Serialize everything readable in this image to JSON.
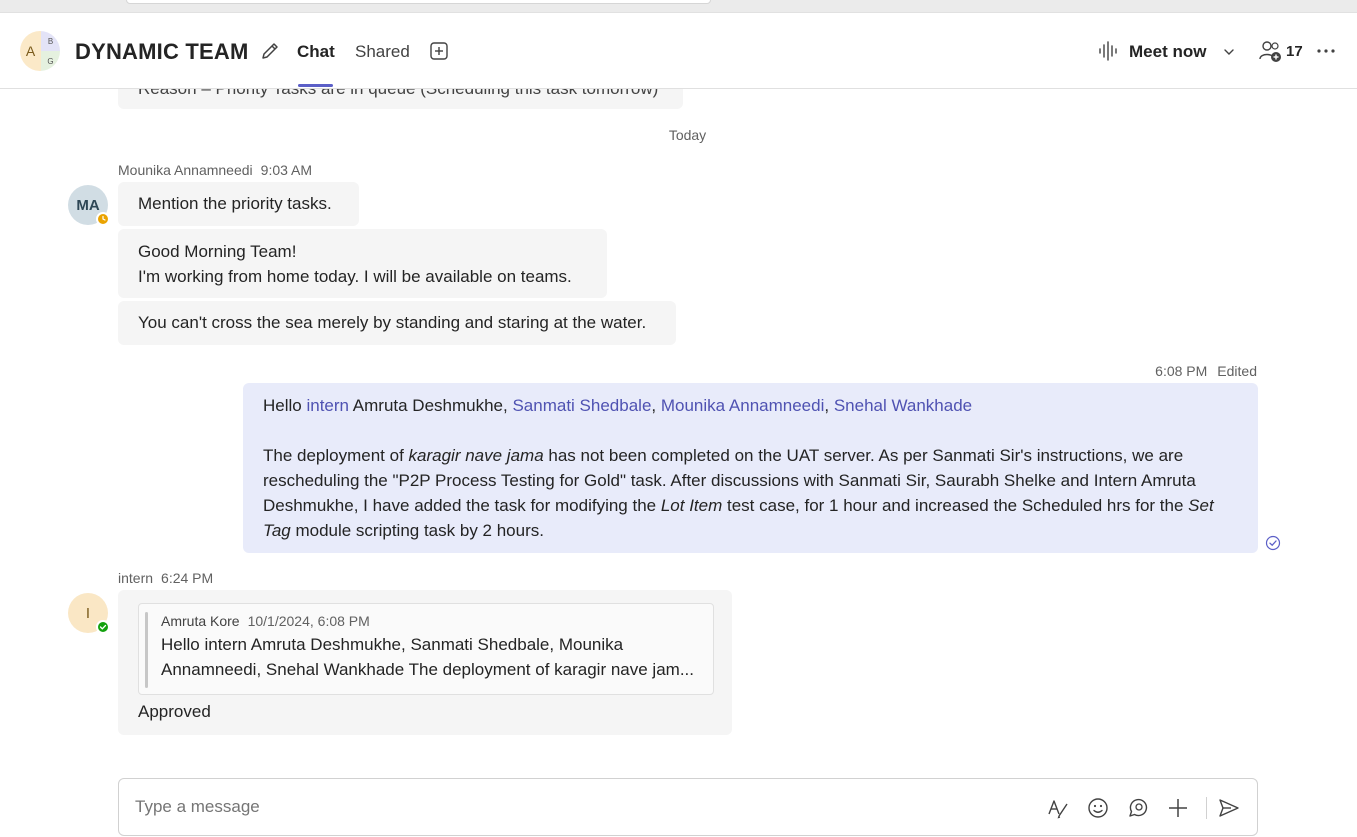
{
  "header": {
    "avatar_letters": {
      "a": "A",
      "b": "B",
      "g": "G"
    },
    "title": "DYNAMIC TEAM",
    "tabs": [
      {
        "label": "Chat"
      },
      {
        "label": "Shared"
      }
    ],
    "meet_label": "Meet now",
    "participant_count": "17"
  },
  "thread": {
    "prev_message_fragment": "Reason – Priority Tasks are in queue (Scheduling this task tomorrow)",
    "day_divider": "Today",
    "group1": {
      "sender": "Mounika Annamneedi",
      "time": "9:03 AM",
      "avatar_initials": "MA",
      "messages": [
        {
          "lines": [
            "Mention the priority tasks."
          ]
        },
        {
          "lines": [
            "Good Morning Team!",
            "I'm working from home today. I will be available on teams."
          ]
        },
        {
          "lines": [
            "You can't cross the sea merely by standing and staring at the water."
          ]
        }
      ]
    },
    "mine": {
      "time": "6:08 PM",
      "status": "Edited",
      "greeting": "Hello ",
      "mention_intern": "intern",
      "name_plain": " Amruta Deshmukhe, ",
      "mention_sanmati": "Sanmati Shedbale",
      "comma1": ", ",
      "mention_mounika": "Mounika Annamneedi",
      "comma2": ", ",
      "mention_snehal": "Snehal Wankhade",
      "p_part1": "The deployment of ",
      "p_italic1": "karagir nave jama",
      "p_part2": " has not been completed on the UAT server. As per Sanmati Sir's instructions, we are rescheduling the \"P2P Process Testing for Gold\" task. After discussions with Sanmati Sir, Saurabh Shelke and Intern Amruta Deshmukhe, I have added the task for modifying the ",
      "p_italic2": "Lot Item",
      "p_part3": " test case, for 1 hour and increased the Scheduled hrs for the ",
      "p_italic3": "Set Tag",
      "p_part4": " module scripting task by 2 hours."
    },
    "reply": {
      "sender": "intern",
      "time": "6:24 PM",
      "avatar_initials": "I",
      "quote_author": "Amruta Kore",
      "quote_time": "10/1/2024, 6:08 PM",
      "quote_line1": "Hello intern Amruta Deshmukhe, Sanmati Shedbale, Mounika",
      "quote_line2": "Annamneedi, Snehal Wankhade The deployment of karagir nave jam...",
      "text": "Approved"
    }
  },
  "composer": {
    "placeholder": "Type a message"
  },
  "colors": {
    "accent": "#5b5fc7",
    "mention": "#4f52b2",
    "my_bubble": "#e8ebfa",
    "other_bubble": "#f5f5f5",
    "presence_away": "#eaa300",
    "presence_online": "#13a10e"
  },
  "icons": [
    "pencil-icon",
    "add-tab-icon",
    "meet-waveform-icon",
    "chevron-down-icon",
    "people-add-icon",
    "more-icon",
    "clock-icon",
    "check-icon",
    "seen-icon",
    "format-icon",
    "emoji-icon",
    "loop-icon",
    "plus-icon",
    "send-icon"
  ]
}
